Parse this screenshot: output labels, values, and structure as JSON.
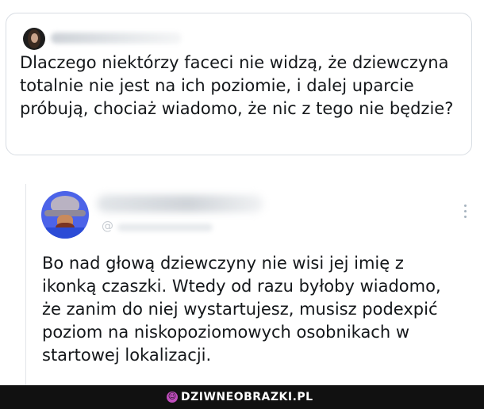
{
  "post": {
    "text": "Dlaczego niektórzy faceci nie widzą, że dziewczyna totalnie nie jest na ich poziomie, i dalej uparcie próbują, chociaż wiadomo, że nic z tego nie będzie?"
  },
  "reply": {
    "handle_prefix": "@",
    "text": "Bo nad głową dziewczyny nie wisi jej imię z ikonką czaszki. Wtedy od razu byłoby wiadomo, że zanim do niej wystartujesz, musisz podexpić poziom na niskopoziomowych osobnikach w startowej lokalizacji."
  },
  "footer": {
    "brand": "DZIWNEOBRAZKI.PL"
  },
  "colors": {
    "text": "#14171a",
    "border": "#d8dde3",
    "footer_bg": "#111111",
    "brand_accent": "#c04dbd"
  }
}
